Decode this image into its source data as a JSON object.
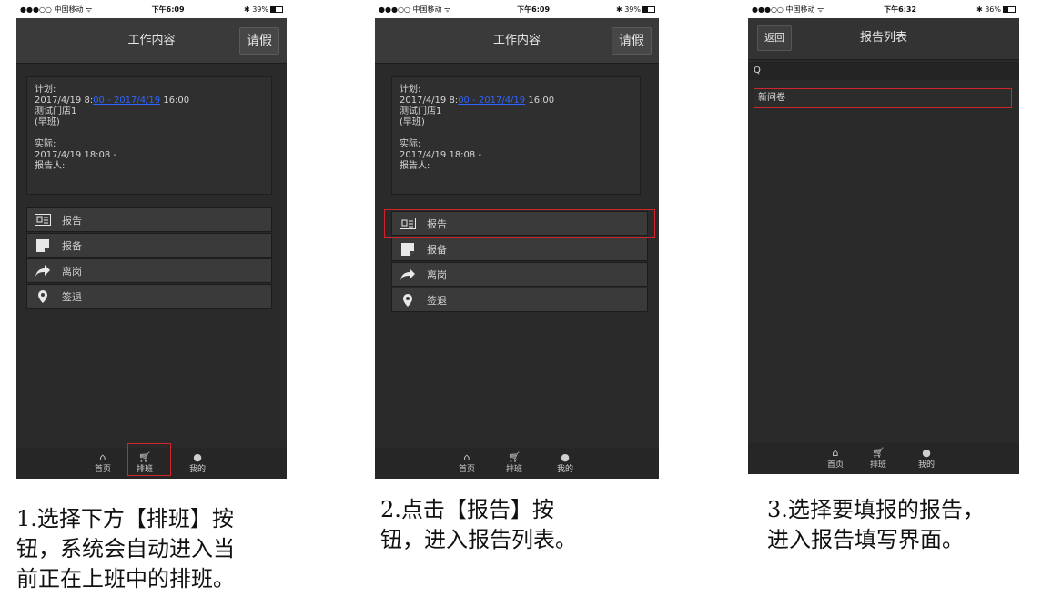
{
  "status_bars": [
    {
      "left": "●●●○○ 中国移动 ᯤ",
      "time": "下午6:09",
      "battery": "✱ 39%"
    },
    {
      "left": "●●●○○ 中国移动 ᯤ",
      "time": "下午6:09",
      "battery": "✱ 39%"
    },
    {
      "left": "●●●○○ 中国移动 ᯤ",
      "time": "下午6:32",
      "battery": "✱ 36%"
    }
  ],
  "work": {
    "title": "工作内容",
    "leave_button": "请假",
    "plan_label": "计划:",
    "plan_start": "2017/4/19 8:",
    "plan_link": "00 - 2017/4/19",
    "plan_end": " 16:00",
    "store": "测试门店1",
    "shift": "(早班)",
    "actual_label": "实际:",
    "actual_time": "2017/4/19 18:08 -",
    "reporter": "报告人:",
    "menu": [
      "报告",
      "报备",
      "离岗",
      "签退"
    ]
  },
  "tabs": {
    "home": "首页",
    "schedule": "排班",
    "me": "我的"
  },
  "report_list": {
    "back_button": "返回",
    "title": "报告列表",
    "search_icon_text": "Q",
    "items": [
      "新问卷"
    ]
  },
  "captions": {
    "step1": [
      "1.选择下方【排班】按",
      "钮，系统会自动进入当",
      "前正在上班中的排班。"
    ],
    "step2": [
      "2.点击【报告】按",
      "钮，进入报告列表。"
    ],
    "step3": [
      "3.选择要填报的报告，",
      "进入报告填写界面。"
    ]
  },
  "colors": {
    "highlight": "#d0262b",
    "link": "#2e64ff",
    "background": "#2a2a2a"
  }
}
